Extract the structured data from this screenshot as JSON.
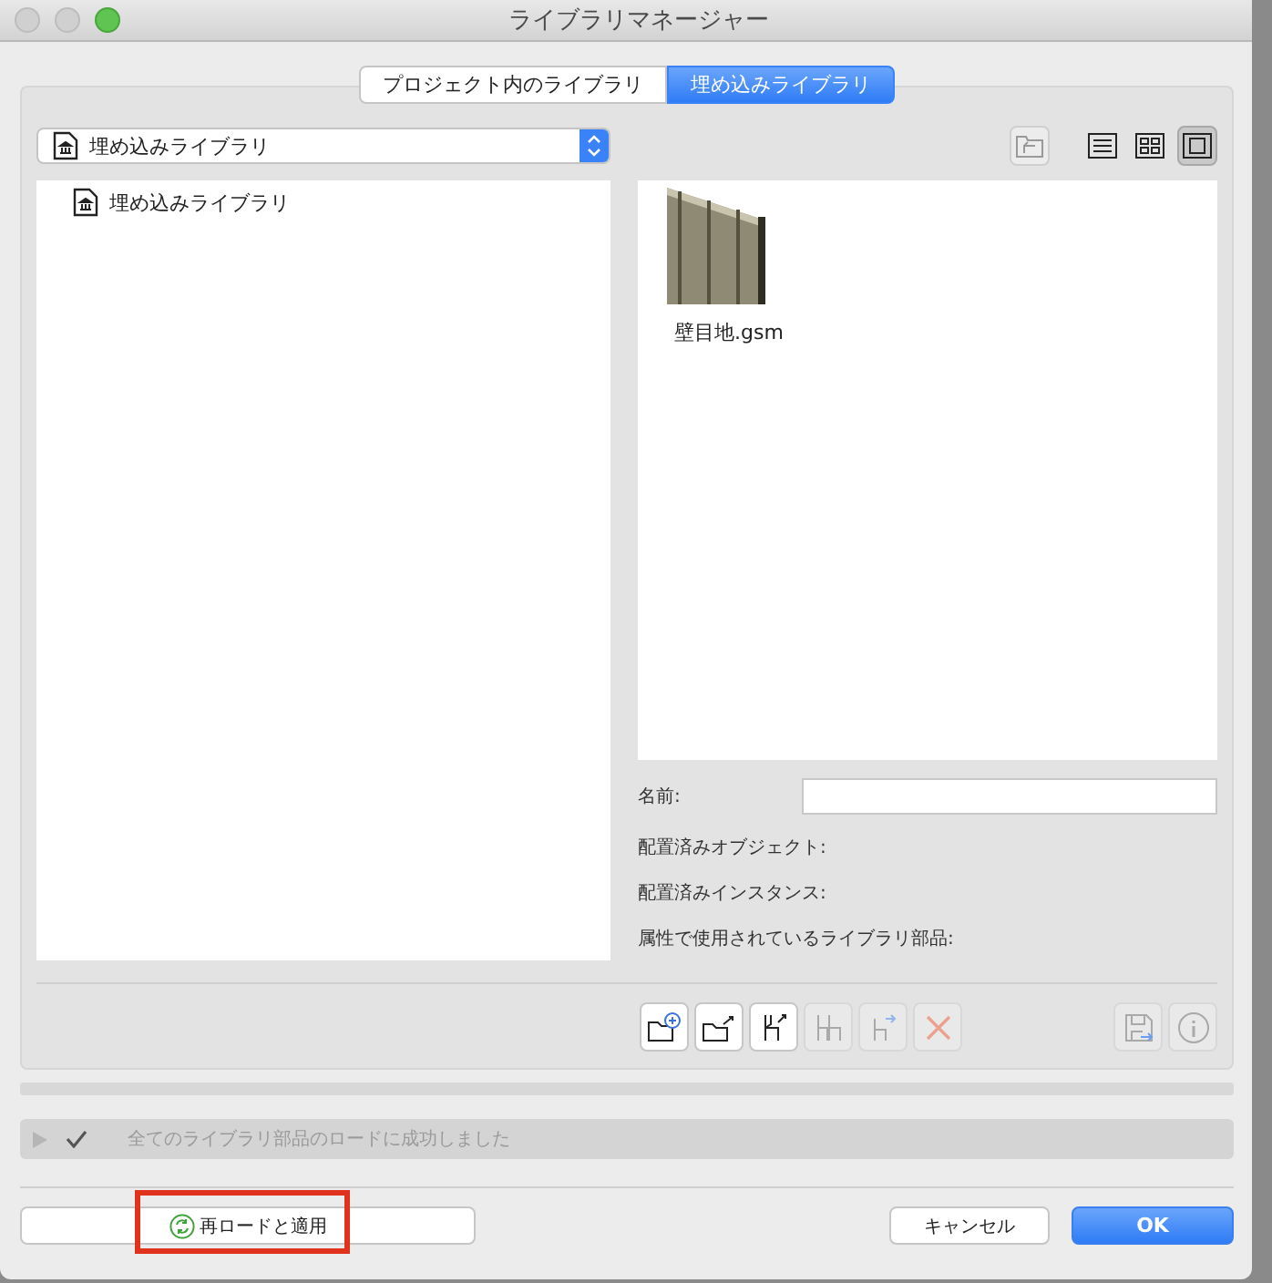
{
  "window": {
    "title": "ライブラリマネージャー"
  },
  "tabs": [
    {
      "label": "プロジェクト内のライブラリ",
      "selected": false
    },
    {
      "label": "埋め込みライブラリ",
      "selected": true
    }
  ],
  "library_dropdown": {
    "value": "埋め込みライブラリ"
  },
  "view_modes": [
    {
      "selected": false
    },
    {
      "selected": false
    },
    {
      "selected": true
    }
  ],
  "tree": {
    "items": [
      {
        "label": "埋め込みライブラリ"
      }
    ]
  },
  "preview": {
    "items": [
      {
        "label": "壁目地.gsm",
        "kind": "picture"
      }
    ]
  },
  "details": {
    "name_label": "名前:",
    "fields": [
      "配置済みオブジェクト:",
      "配置済みインスタンス:",
      "属性で使用されているライブラリ部品:"
    ]
  },
  "toolbar": [
    {
      "disabled": false
    },
    {
      "disabled": false
    },
    {
      "disabled": false
    },
    {
      "disabled": true
    },
    {
      "disabled": true
    },
    {
      "disabled": true
    }
  ],
  "toolbar_right": [
    {
      "disabled": true
    },
    {
      "disabled": true
    }
  ],
  "status": {
    "expanded": false,
    "message": "全てのライブラリ部品のロードに成功しました"
  },
  "buttons": {
    "reload": "再ロードと適用",
    "cancel": "キャンセル",
    "ok": "OK"
  }
}
